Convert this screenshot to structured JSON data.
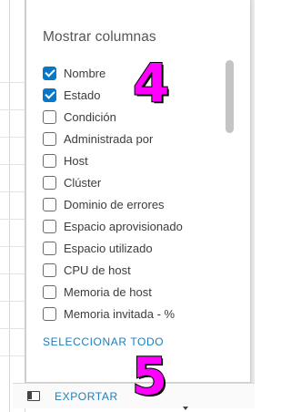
{
  "panel": {
    "title": "Mostrar columnas",
    "select_all_label": "SELECCIONAR TODO",
    "columns": [
      {
        "label": "Nombre",
        "checked": true
      },
      {
        "label": "Estado",
        "checked": true
      },
      {
        "label": "Condición",
        "checked": false
      },
      {
        "label": "Administrada por",
        "checked": false
      },
      {
        "label": "Host",
        "checked": false
      },
      {
        "label": "Clúster",
        "checked": false
      },
      {
        "label": "Dominio de errores",
        "checked": false
      },
      {
        "label": "Espacio aprovisionado",
        "checked": false
      },
      {
        "label": "Espacio utilizado",
        "checked": false
      },
      {
        "label": "CPU de host",
        "checked": false
      },
      {
        "label": "Memoria de host",
        "checked": false
      },
      {
        "label": "Memoria invitada - %",
        "checked": false
      },
      {
        "label": "",
        "checked": false
      }
    ]
  },
  "toolbar": {
    "columns_icon": "columns-icon",
    "export_label": "EXPORTAR"
  },
  "markers": {
    "step_a": "4",
    "step_b": "5"
  },
  "colors": {
    "accent": "#0a76c8",
    "link": "#1a7fbf",
    "marker": "#ff00ff"
  }
}
